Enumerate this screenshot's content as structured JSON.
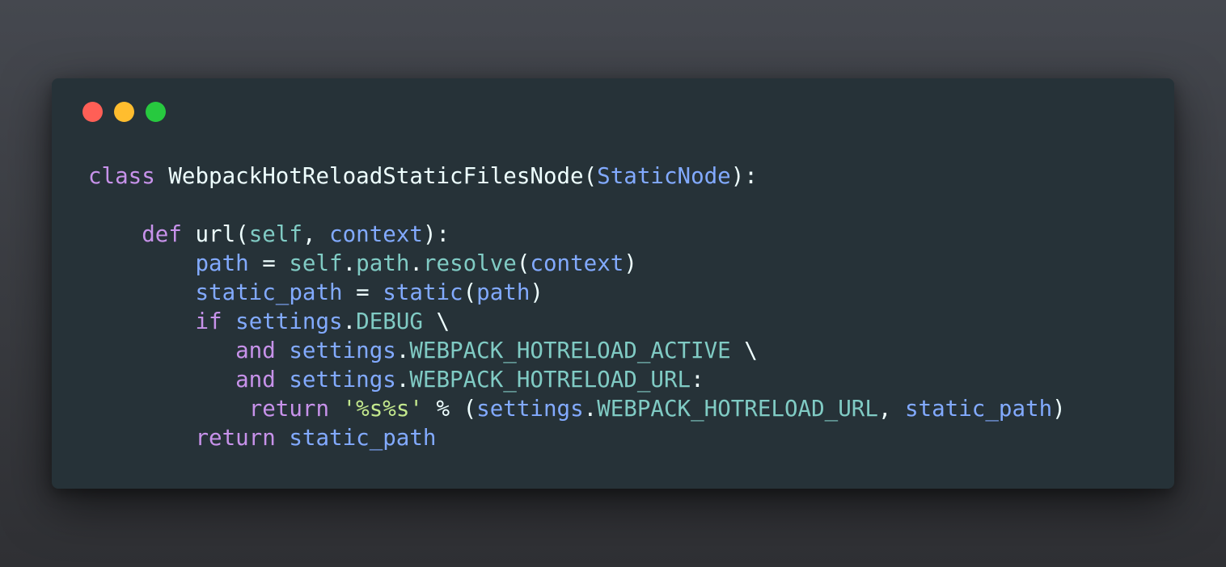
{
  "window": {
    "controls": [
      "close",
      "minimize",
      "maximize"
    ],
    "colors": {
      "background": "#263238",
      "close": "#ff5f56",
      "minimize": "#ffbd2e",
      "maximize": "#27c93f"
    }
  },
  "code": {
    "language": "python",
    "lines": [
      [
        [
          "kw",
          "class"
        ],
        [
          "punc",
          " "
        ],
        [
          "cls",
          "WebpackHotReloadStaticFilesNode"
        ],
        [
          "punc",
          "("
        ],
        [
          "base",
          "StaticNode"
        ],
        [
          "punc",
          "):"
        ]
      ],
      [],
      [
        [
          "punc",
          "    "
        ],
        [
          "kw",
          "def"
        ],
        [
          "punc",
          " "
        ],
        [
          "fn",
          "url"
        ],
        [
          "punc",
          "("
        ],
        [
          "self",
          "self"
        ],
        [
          "punc",
          ", "
        ],
        [
          "var",
          "context"
        ],
        [
          "punc",
          "):"
        ]
      ],
      [
        [
          "punc",
          "        "
        ],
        [
          "var",
          "path"
        ],
        [
          "op",
          " = "
        ],
        [
          "self",
          "self"
        ],
        [
          "punc",
          "."
        ],
        [
          "attr",
          "path"
        ],
        [
          "punc",
          "."
        ],
        [
          "attr",
          "resolve"
        ],
        [
          "punc",
          "("
        ],
        [
          "var",
          "context"
        ],
        [
          "punc",
          ")"
        ]
      ],
      [
        [
          "punc",
          "        "
        ],
        [
          "var",
          "static_path"
        ],
        [
          "op",
          " = "
        ],
        [
          "call",
          "static"
        ],
        [
          "punc",
          "("
        ],
        [
          "var",
          "path"
        ],
        [
          "punc",
          ")"
        ]
      ],
      [
        [
          "punc",
          "        "
        ],
        [
          "kw",
          "if"
        ],
        [
          "punc",
          " "
        ],
        [
          "var",
          "settings"
        ],
        [
          "punc",
          "."
        ],
        [
          "attr",
          "DEBUG"
        ],
        [
          "punc",
          " \\"
        ]
      ],
      [
        [
          "punc",
          "           "
        ],
        [
          "kw",
          "and"
        ],
        [
          "punc",
          " "
        ],
        [
          "var",
          "settings"
        ],
        [
          "punc",
          "."
        ],
        [
          "attr",
          "WEBPACK_HOTRELOAD_ACTIVE"
        ],
        [
          "punc",
          " \\"
        ]
      ],
      [
        [
          "punc",
          "           "
        ],
        [
          "kw",
          "and"
        ],
        [
          "punc",
          " "
        ],
        [
          "var",
          "settings"
        ],
        [
          "punc",
          "."
        ],
        [
          "attr",
          "WEBPACK_HOTRELOAD_URL"
        ],
        [
          "punc",
          ":"
        ]
      ],
      [
        [
          "punc",
          "            "
        ],
        [
          "kw",
          "return"
        ],
        [
          "punc",
          " "
        ],
        [
          "str",
          "'%s%s'"
        ],
        [
          "op",
          " % "
        ],
        [
          "punc",
          "("
        ],
        [
          "var",
          "settings"
        ],
        [
          "punc",
          "."
        ],
        [
          "attr",
          "WEBPACK_HOTRELOAD_URL"
        ],
        [
          "punc",
          ", "
        ],
        [
          "var",
          "static_path"
        ],
        [
          "punc",
          ")"
        ]
      ],
      [
        [
          "punc",
          "        "
        ],
        [
          "kw",
          "return"
        ],
        [
          "punc",
          " "
        ],
        [
          "var",
          "static_path"
        ]
      ]
    ]
  }
}
